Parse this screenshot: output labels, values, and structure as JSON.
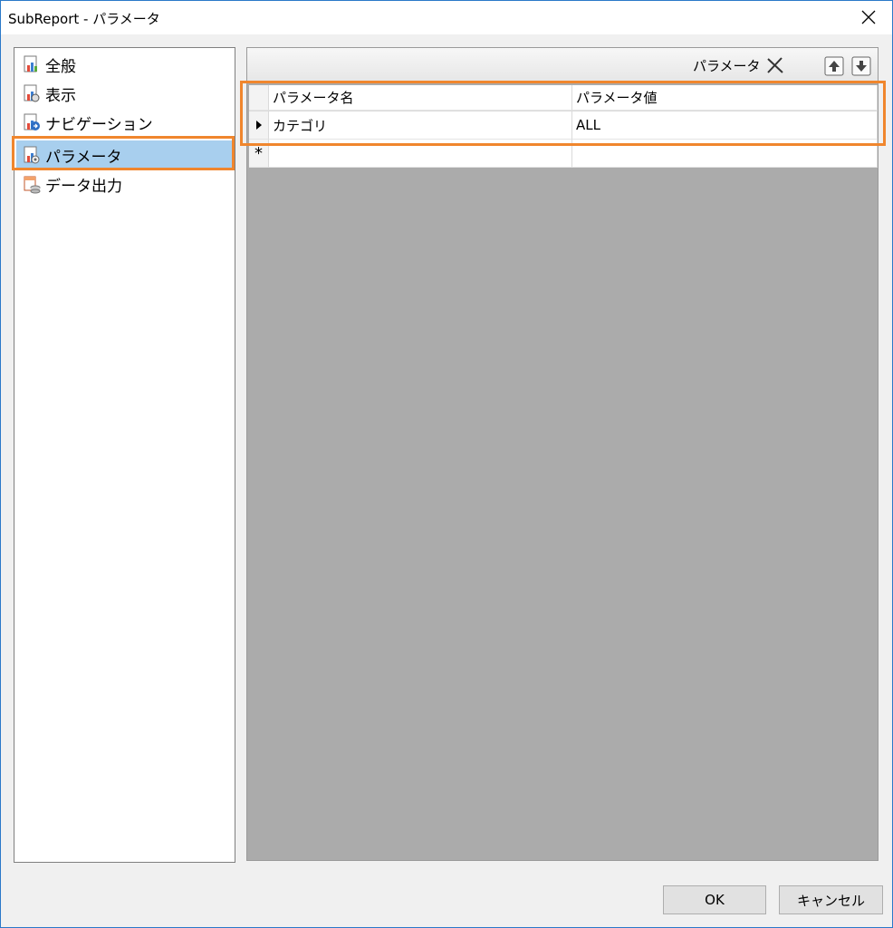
{
  "window": {
    "title": "SubReport - パラメータ"
  },
  "sidebar": {
    "items": [
      {
        "label": "全般",
        "icon": "report-chart-icon"
      },
      {
        "label": "表示",
        "icon": "report-view-icon"
      },
      {
        "label": "ナビゲーション",
        "icon": "report-navigation-icon"
      },
      {
        "label": "パラメータ",
        "icon": "report-parameter-icon",
        "selected": true
      },
      {
        "label": "データ出力",
        "icon": "data-output-icon"
      }
    ]
  },
  "toolbar": {
    "label": "パラメータ"
  },
  "grid": {
    "columns": [
      "パラメータ名",
      "パラメータ値"
    ],
    "rows": [
      {
        "name": "カテゴリ",
        "value": "ALL"
      }
    ],
    "new_row_marker": "*"
  },
  "buttons": {
    "ok": "OK",
    "cancel": "キャンセル"
  },
  "colors": {
    "highlight": "#f0862d",
    "selected": "#a8cfee",
    "grid_bg": "#ababab"
  }
}
